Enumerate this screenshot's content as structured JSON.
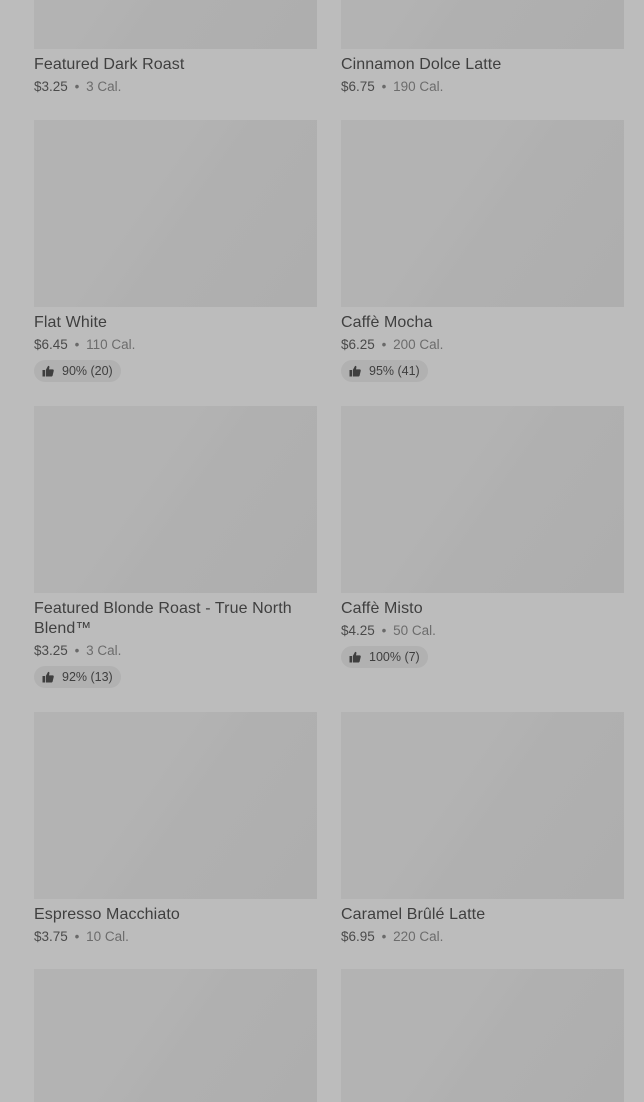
{
  "menu": {
    "products": [
      {
        "name": "Featured Dark Roast",
        "price": "$3.25",
        "separator": "•",
        "calories": "3 Cal.",
        "rating": null
      },
      {
        "name": "Cinnamon Dolce Latte",
        "price": "$6.75",
        "separator": "•",
        "calories": "190 Cal.",
        "rating": null
      },
      {
        "name": "Flat White",
        "price": "$6.45",
        "separator": "•",
        "calories": "110 Cal.",
        "rating": "90% (20)"
      },
      {
        "name": "Caffè Mocha",
        "price": "$6.25",
        "separator": "•",
        "calories": "200 Cal.",
        "rating": "95% (41)"
      },
      {
        "name": "Featured Blonde Roast - True North Blend™",
        "price": "$3.25",
        "separator": "•",
        "calories": "3 Cal.",
        "rating": "92% (13)"
      },
      {
        "name": "Caffè Misto",
        "price": "$4.25",
        "separator": "•",
        "calories": "50 Cal.",
        "rating": "100% (7)"
      },
      {
        "name": "Espresso Macchiato",
        "price": "$3.75",
        "separator": "•",
        "calories": "10 Cal.",
        "rating": null
      },
      {
        "name": "Caramel Brûlé Latte",
        "price": "$6.95",
        "separator": "•",
        "calories": "220 Cal.",
        "rating": null
      }
    ],
    "rating_icon": "thumbs-up-icon",
    "colors": {
      "background": "#bcbcbc",
      "image_placeholder": "#b3b3b3",
      "title_text": "#3f3f3f",
      "rating_pill": "#b1b1b1"
    }
  }
}
